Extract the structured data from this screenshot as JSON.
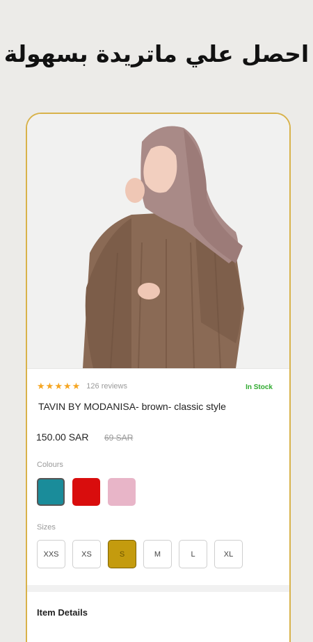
{
  "headline": "احصل علي ماتريدة بسهولة",
  "product": {
    "rating_stars": 5,
    "reviews": "126 reviews",
    "stock": "In Stock",
    "title": "TAVIN BY MODANISA- brown- classic style",
    "price": "150.00 SAR",
    "old_price": "69 SAR",
    "image_alt": "brown abaya with hijab"
  },
  "colours": {
    "label": "Colours",
    "items": [
      {
        "name": "teal",
        "hex": "#1a8c9a"
      },
      {
        "name": "red",
        "hex": "#d90d0d"
      },
      {
        "name": "pink",
        "hex": "#e8b5c8"
      }
    ]
  },
  "sizes": {
    "label": "Sizes",
    "items": [
      "XXS",
      "XS",
      "S",
      "M",
      "L",
      "XL"
    ],
    "selected": "S"
  },
  "item_details": {
    "label": "Item Details"
  },
  "colors": {
    "accent_gold": "#d8b24a",
    "selected_size": "#c49b0e",
    "in_stock": "#2faa2f",
    "star": "#f5a623"
  }
}
